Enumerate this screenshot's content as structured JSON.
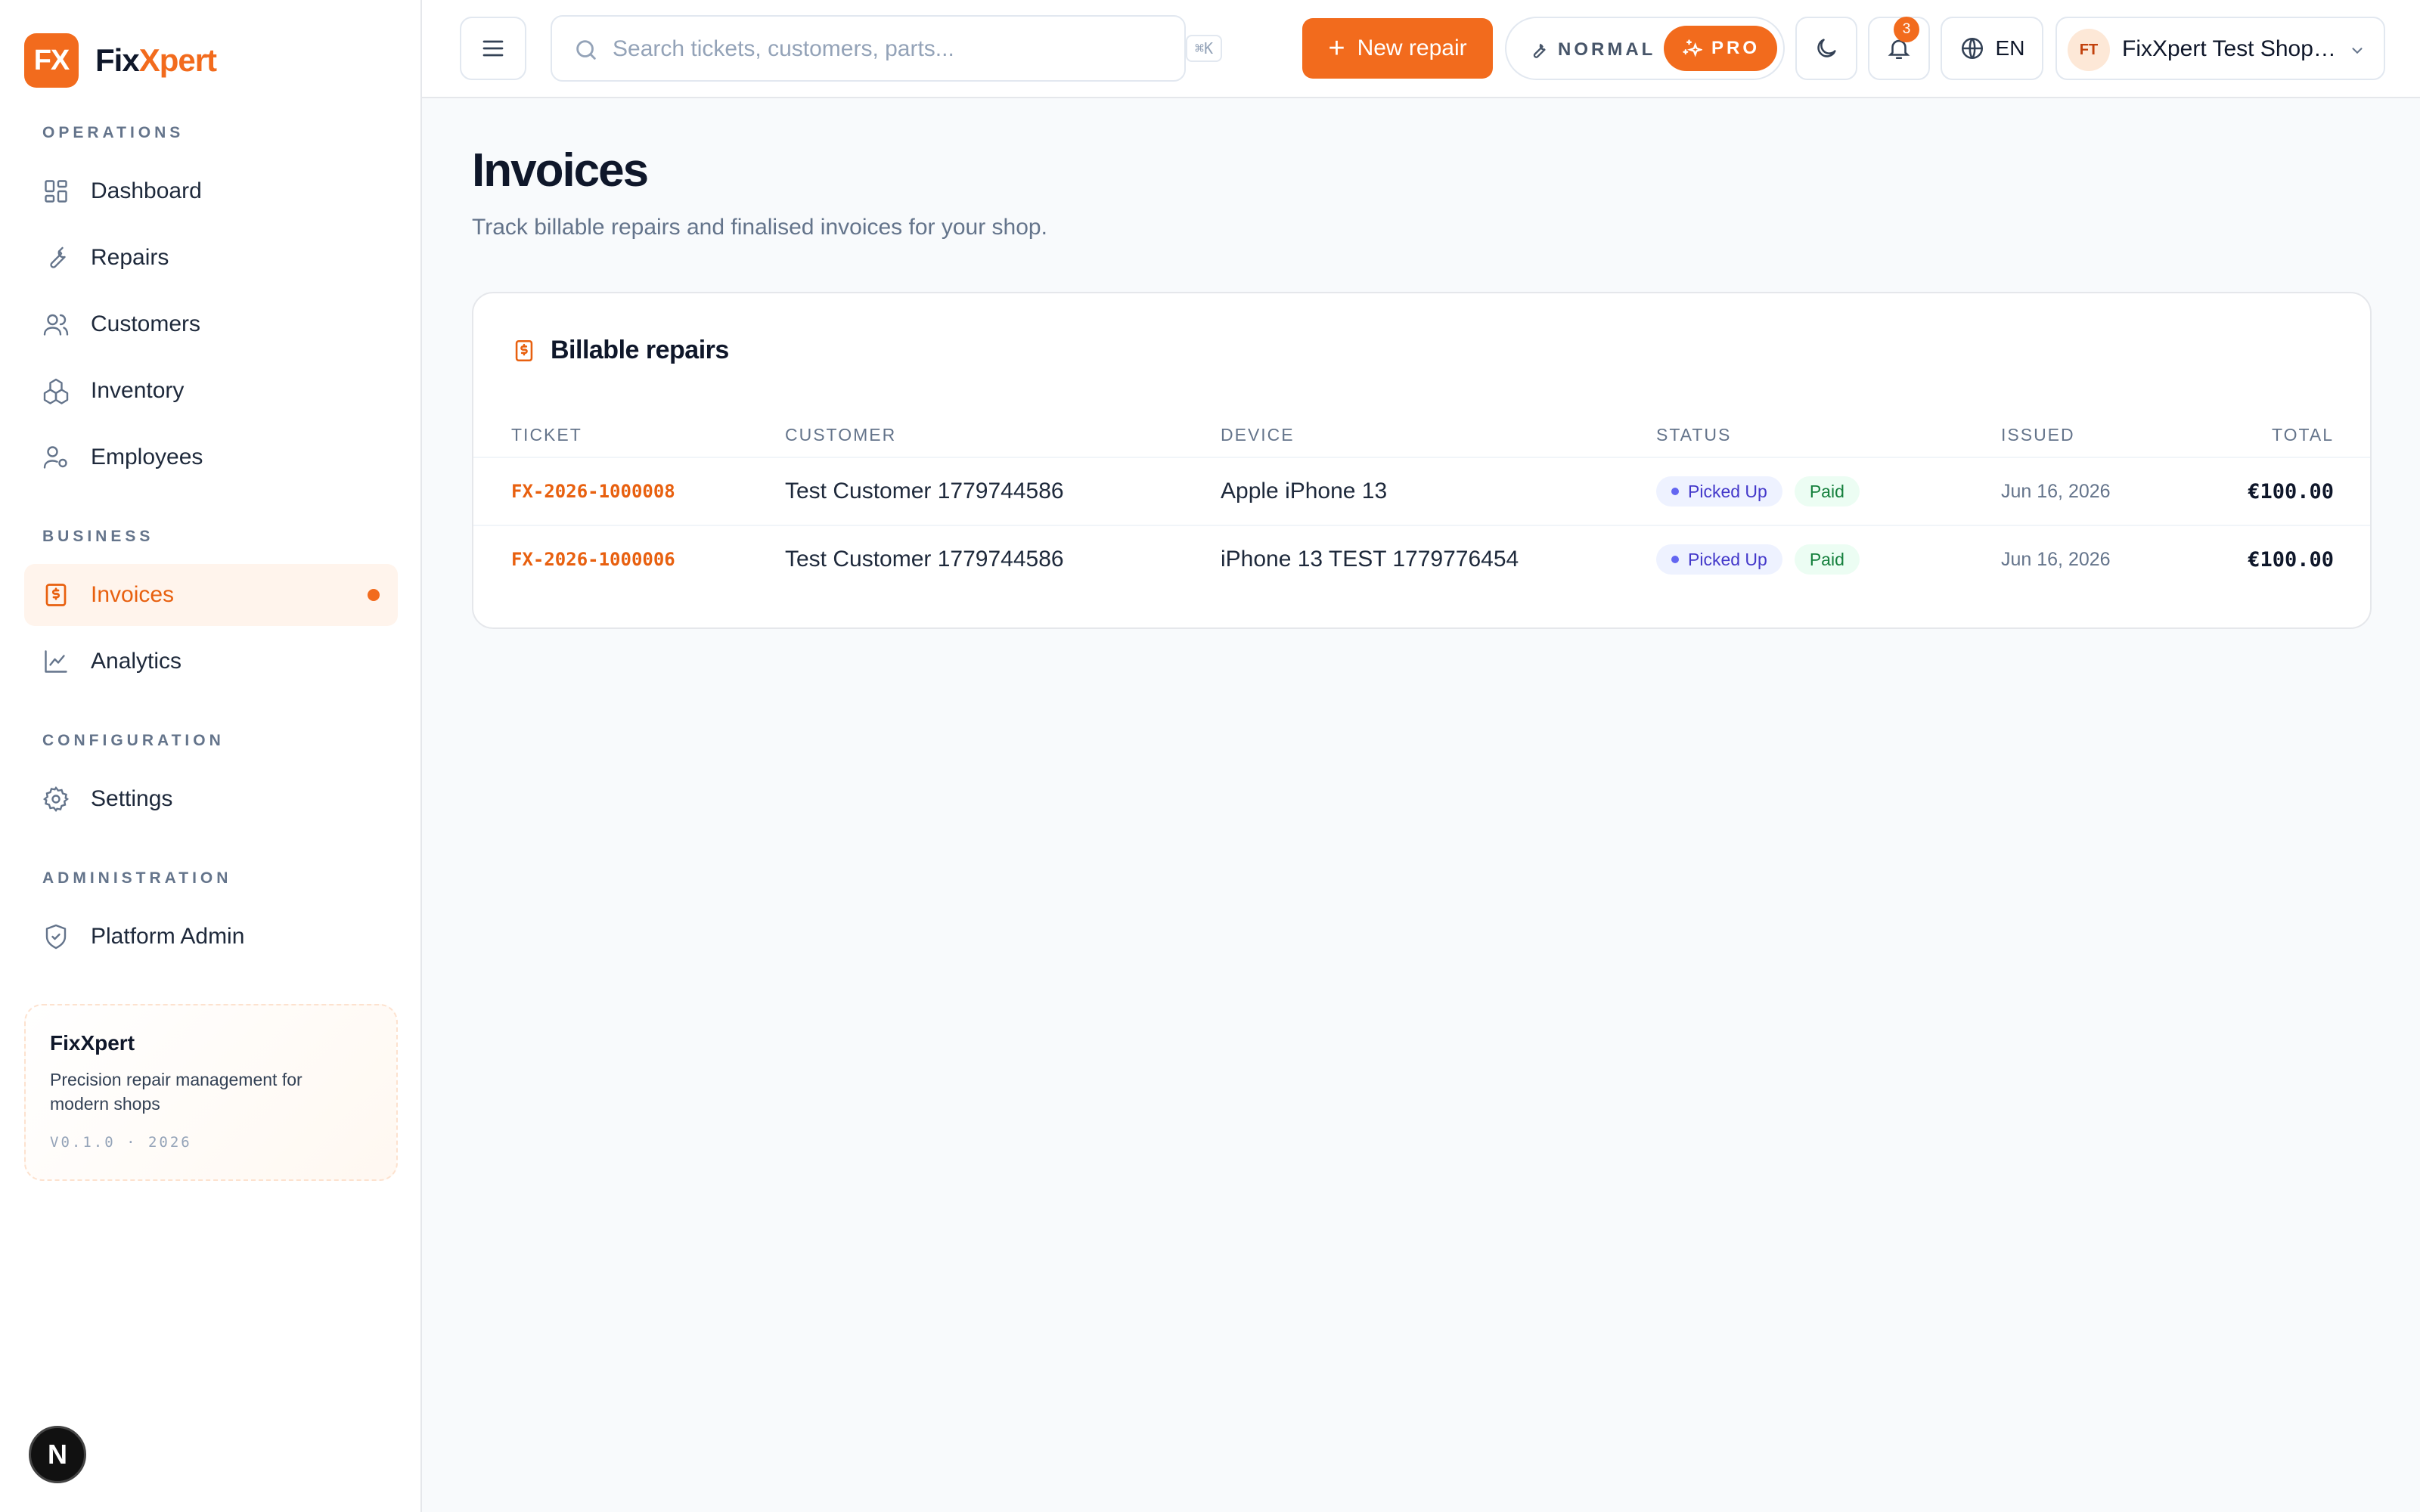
{
  "brand": {
    "logo_text": "FX",
    "name_part1": "Fix",
    "name_part2": "Xpert"
  },
  "sidebar": {
    "sections": [
      {
        "label": "OPERATIONS"
      },
      {
        "label": "BUSINESS"
      },
      {
        "label": "CONFIGURATION"
      },
      {
        "label": "ADMINISTRATION"
      }
    ],
    "items": [
      {
        "label": "Dashboard",
        "icon": "dashboard-icon"
      },
      {
        "label": "Repairs",
        "icon": "wrench-icon"
      },
      {
        "label": "Customers",
        "icon": "users-icon"
      },
      {
        "label": "Inventory",
        "icon": "boxes-icon"
      },
      {
        "label": "Employees",
        "icon": "user-cog-icon"
      },
      {
        "label": "Invoices",
        "icon": "receipt-icon",
        "active": true
      },
      {
        "label": "Analytics",
        "icon": "chart-line-icon"
      },
      {
        "label": "Settings",
        "icon": "gear-icon"
      },
      {
        "label": "Platform Admin",
        "icon": "shield-icon"
      }
    ],
    "promo": {
      "title": "FixXpert",
      "description": "Precision repair management for modern shops",
      "version": "V0.1.0 · 2026"
    },
    "dev_badge": "N"
  },
  "topbar": {
    "search_placeholder": "Search tickets, customers, parts...",
    "search_value": "",
    "shortcut_hint": "⌘K",
    "new_repair_label": "New repair",
    "mode_normal_label": "NORMAL",
    "mode_pro_label": "PRO",
    "notification_count": "3",
    "language": "EN",
    "shop_initials": "FT",
    "shop_name": "FixXpert Test Shop Limited"
  },
  "main": {
    "title": "Invoices",
    "subtitle": "Track billable repairs and finalised invoices for your shop.",
    "card_title": "Billable repairs",
    "columns": [
      "TICKET",
      "CUSTOMER",
      "DEVICE",
      "STATUS",
      "ISSUED",
      "TOTAL"
    ],
    "rows": [
      {
        "ticket": "FX-2026-1000008",
        "customer": "Test Customer 1779744586",
        "device": "Apple iPhone 13",
        "status": "Picked Up",
        "payment": "Paid",
        "issued": "Jun 16, 2026",
        "total": "€100.00"
      },
      {
        "ticket": "FX-2026-1000006",
        "customer": "Test Customer 1779744586",
        "device": "iPhone 13 TEST 1779776454",
        "status": "Picked Up",
        "payment": "Paid",
        "issued": "Jun 16, 2026",
        "total": "€100.00"
      }
    ]
  },
  "colors": {
    "accent": "#f26b1d",
    "status_bg": "#eef2ff",
    "paid_bg": "#ecfdf3"
  }
}
